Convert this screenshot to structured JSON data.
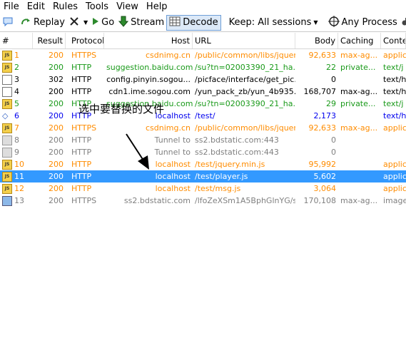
{
  "menu": [
    "File",
    "Edit",
    "Rules",
    "Tools",
    "View",
    "Help"
  ],
  "toolbar": {
    "replay": "Replay",
    "remove": "",
    "go": "Go",
    "stream": "Stream",
    "decode": "Decode",
    "keep": "Keep: All sessions",
    "process": "Any Process",
    "find": "F"
  },
  "columns": [
    "#",
    "Result",
    "Protocol",
    "Host",
    "URL",
    "Body",
    "Caching",
    "Conte"
  ],
  "rows": [
    {
      "num": "1",
      "result": "200",
      "protocol": "HTTPS",
      "host": "csdnimg.cn",
      "url": "/public/common/libs/jquer...",
      "body": "92,633",
      "caching": "max-ag...",
      "content": "applic",
      "color": "orange",
      "icon": "js"
    },
    {
      "num": "2",
      "result": "200",
      "protocol": "HTTP",
      "host": "suggestion.baidu.com",
      "url": "/su?tn=02003390_21_ha...",
      "body": "22",
      "caching": "private...",
      "content": "text/j",
      "color": "green",
      "icon": "js"
    },
    {
      "num": "3",
      "result": "302",
      "protocol": "HTTP",
      "host": "config.pinyin.sogou...",
      "url": "/picface/interface/get_pic...",
      "body": "0",
      "caching": "",
      "content": "text/h",
      "color": "black",
      "icon": "302"
    },
    {
      "num": "4",
      "result": "200",
      "protocol": "HTTP",
      "host": "cdn1.ime.sogou.com",
      "url": "/yun_pack_zb/yun_4b935...",
      "body": "168,707",
      "caching": "max-ag...",
      "content": "text/h",
      "color": "black",
      "icon": "doc"
    },
    {
      "num": "5",
      "result": "200",
      "protocol": "HTTP",
      "host": "suggestion.baidu.com",
      "url": "/su?tn=02003390_21_ha...",
      "body": "29",
      "caching": "private...",
      "content": "text/j",
      "color": "green",
      "icon": "js"
    },
    {
      "num": "6",
      "result": "200",
      "protocol": "HTTP",
      "host": "localhost",
      "url": "/test/",
      "body": "2,173",
      "caching": "",
      "content": "text/h",
      "color": "blue",
      "icon": "html"
    },
    {
      "num": "7",
      "result": "200",
      "protocol": "HTTPS",
      "host": "csdnimg.cn",
      "url": "/public/common/libs/jquer...",
      "body": "92,633",
      "caching": "max-ag...",
      "content": "applic",
      "color": "orange",
      "icon": "js"
    },
    {
      "num": "8",
      "result": "200",
      "protocol": "HTTP",
      "host": "Tunnel to",
      "url": "ss2.bdstatic.com:443",
      "body": "0",
      "caching": "",
      "content": "",
      "color": "gray",
      "icon": "tunnel"
    },
    {
      "num": "9",
      "result": "200",
      "protocol": "HTTP",
      "host": "Tunnel to",
      "url": "ss2.bdstatic.com:443",
      "body": "0",
      "caching": "",
      "content": "",
      "color": "gray",
      "icon": "tunnel"
    },
    {
      "num": "10",
      "result": "200",
      "protocol": "HTTP",
      "host": "localhost",
      "url": "/test/jquery.min.js",
      "body": "95,992",
      "caching": "",
      "content": "applic",
      "color": "orange",
      "icon": "js"
    },
    {
      "num": "11",
      "result": "200",
      "protocol": "HTTP",
      "host": "localhost",
      "url": "/test/player.js",
      "body": "5,602",
      "caching": "",
      "content": "applic",
      "color": "orange",
      "icon": "js",
      "selected": true
    },
    {
      "num": "12",
      "result": "200",
      "protocol": "HTTP",
      "host": "localhost",
      "url": "/test/msg.js",
      "body": "3,064",
      "caching": "",
      "content": "applic",
      "color": "orange",
      "icon": "js"
    },
    {
      "num": "13",
      "result": "200",
      "protocol": "HTTPS",
      "host": "ss2.bdstatic.com",
      "url": "/lfoZeXSm1A5BphGlnYG/s...",
      "body": "170,108",
      "caching": "max-ag...",
      "content": "image",
      "color": "gray",
      "icon": "img"
    }
  ],
  "annotation": "选中要替换的文件"
}
